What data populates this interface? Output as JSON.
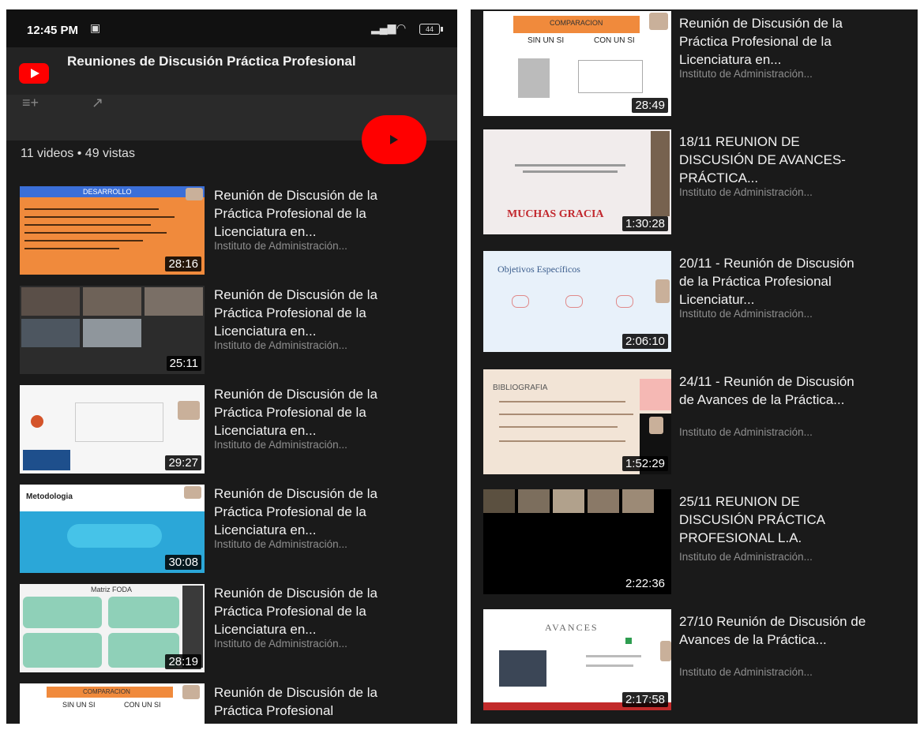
{
  "status_bar": {
    "time": "12:45 PM",
    "battery": "44"
  },
  "playlist": {
    "title": "Reuniones de Discusión Práctica Profesional",
    "stats": "11 videos • 49 vistas"
  },
  "colors": {
    "accent": "#ff0000",
    "background": "#1a1a1a",
    "channel_text": "#8e8e8e"
  },
  "left_videos": [
    {
      "title": "Reunión de Discusión de la Práctica Profesional de la Licenciatura en...",
      "channel": "Instituto de Administración...",
      "duration": "28:16",
      "slide_label": "DESARROLLO"
    },
    {
      "title": "Reunión de Discusión de la Práctica Profesional de la Licenciatura en...",
      "channel": "Instituto de Administración...",
      "duration": "25:11"
    },
    {
      "title": "Reunión de Discusión de la Práctica Profesional de la Licenciatura en...",
      "channel": "Instituto de Administración...",
      "duration": "29:27"
    },
    {
      "title": "Reunión de Discusión de la Práctica Profesional de la Licenciatura en...",
      "channel": "Instituto de Administración...",
      "duration": "30:08",
      "slide_label": "Metodologia"
    },
    {
      "title": "Reunión de Discusión de la Práctica Profesional de la Licenciatura en...",
      "channel": "Instituto de Administración...",
      "duration": "28:19",
      "slide_label": "Matriz FODA"
    },
    {
      "title": "Reunión de Discusión de la Práctica Profesional",
      "slide_label": "COMPARACION",
      "slide_col1": "SIN UN SI",
      "slide_col2": "CON UN SI"
    }
  ],
  "right_videos": [
    {
      "title": "Reunión de Discusión de la Práctica Profesional de la Licenciatura en...",
      "channel": "Instituto de Administración...",
      "duration": "28:49",
      "slide_label": "COMPARACION",
      "slide_col1": "SIN UN SI",
      "slide_col2": "CON UN SI"
    },
    {
      "title": "18/11 REUNION DE DISCUSIÓN DE AVANCES- PRÁCTICA...",
      "channel": "Instituto de Administración...",
      "duration": "1:30:28",
      "slide_label": "MUCHAS GRACIA"
    },
    {
      "title": "20/11 - Reunión de Discusión de la Práctica Profesional Licenciatur...",
      "channel": "Instituto de Administración...",
      "duration": "2:06:10",
      "slide_label": "Objetivos Específicos"
    },
    {
      "title": "24/11 - Reunión de Discusión de Avances de la Práctica...",
      "channel": "Instituto de Administración...",
      "duration": "1:52:29",
      "slide_label": "BIBLIOGRAFIA"
    },
    {
      "title": "25/11 REUNION DE DISCUSIÓN PRÁCTICA PROFESIONAL L.A.",
      "channel": "Instituto de Administración...",
      "duration": "2:22:36"
    },
    {
      "title": "27/10 Reunión de Discusión de Avances de la Práctica...",
      "channel": "Instituto de Administración...",
      "duration": "2:17:58",
      "slide_label": "AVANCES"
    }
  ]
}
